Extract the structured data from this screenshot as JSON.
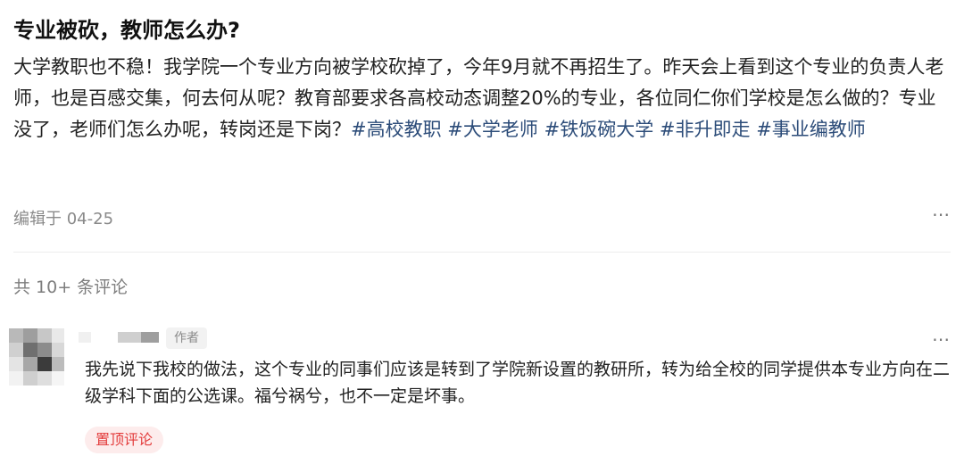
{
  "post": {
    "title": "专业被砍，教师怎么办?",
    "body_text": "大学教职也不稳！我学院一个专业方向被学校砍掉了，今年9月就不再招生了。昨天会上看到这个专业的负责人老师，也是百感交集，何去何从呢？教育部要求各高校动态调整20%的专业，各位同仁你们学校是怎么做的？专业没了，老师们怎么办呢，转岗还是下岗？",
    "tags": [
      "#高校教职",
      "#大学老师",
      "#铁饭碗大学",
      "#非升即走",
      "#事业编教师"
    ],
    "edit_time": "编辑于 04-25",
    "more_icon": "⋯"
  },
  "comments_header": {
    "count_text": "共 10+ 条评论"
  },
  "comment": {
    "author_badge": "作者",
    "text": "我先说下我校的做法，这个专业的同事们应该是转到了学院新设置的教研所，转为给全校的同学提供本专业方向在二级学科下面的公选课。福兮祸兮，也不一定是坏事。",
    "pin_label": "置顶评论",
    "more_icon": "⋯"
  },
  "colors": {
    "tag": "#2c4c79",
    "pin_text": "#e33b3b",
    "pin_bg": "#fdecec",
    "muted": "#8a8a8a"
  }
}
